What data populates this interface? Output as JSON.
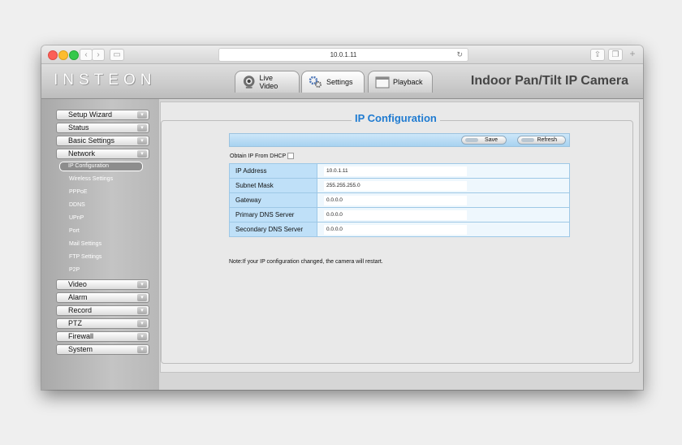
{
  "browser": {
    "url": "10.0.1.11"
  },
  "header": {
    "logo": "INSTEON",
    "tabs": [
      {
        "label": "Live Video",
        "icon": "webcam-icon"
      },
      {
        "label": "Settings",
        "icon": "gears-icon"
      },
      {
        "label": "Playback",
        "icon": "film-icon"
      }
    ],
    "product": "Indoor Pan/Tilt IP Camera"
  },
  "sidebar": {
    "menus_top": [
      "Setup Wizard",
      "Status",
      "Basic Settings",
      "Network"
    ],
    "network_items": [
      "IP Configuration",
      "Wireless Settings",
      "PPPoE",
      "DDNS",
      "UPnP",
      "Port",
      "Mail Settings",
      "FTP Settings",
      "P2P"
    ],
    "menus_bottom": [
      "Video",
      "Alarm",
      "Record",
      "PTZ",
      "Firewall",
      "System"
    ]
  },
  "page": {
    "title": "IP Configuration",
    "save_label": "Save",
    "refresh_label": "Refresh",
    "dhcp_label": "Obtain IP From DHCP",
    "fields": [
      {
        "label": "IP Address",
        "value": "10.0.1.11"
      },
      {
        "label": "Subnet Mask",
        "value": "255.255.255.0"
      },
      {
        "label": "Gateway",
        "value": "0.0.0.0"
      },
      {
        "label": "Primary DNS Server",
        "value": "0.0.0.0"
      },
      {
        "label": "Secondary DNS Server",
        "value": "0.0.0.0"
      }
    ],
    "note": "Note:If your IP configuration changed, the camera will restart."
  }
}
